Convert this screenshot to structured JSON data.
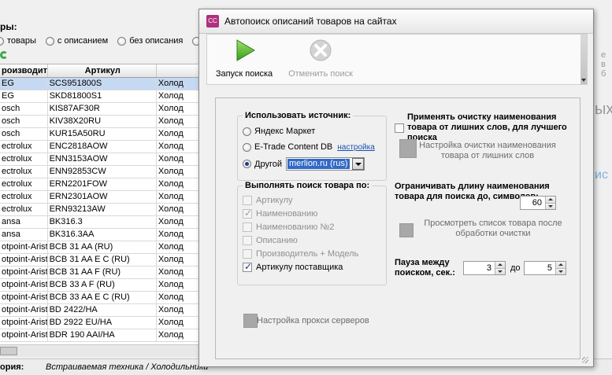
{
  "background": {
    "filter_label": "ры:",
    "radio_options": [
      {
        "label": "товары",
        "checked": true
      },
      {
        "label": "с описанием",
        "checked": false
      },
      {
        "label": "без описания",
        "checked": false
      },
      {
        "label": "пр",
        "checked": false
      }
    ],
    "grid": {
      "columns": [
        "роизводите",
        "Артикул",
        ""
      ],
      "rows": [
        {
          "maker": "EG",
          "article": "SCS951800S",
          "category": "Холод"
        },
        {
          "maker": "EG",
          "article": "SKD81800S1",
          "category": "Холод"
        },
        {
          "maker": "osch",
          "article": "KIS87AF30R",
          "category": "Холод"
        },
        {
          "maker": "osch",
          "article": "KIV38X20RU",
          "category": "Холод"
        },
        {
          "maker": "osch",
          "article": "KUR15A50RU",
          "category": "Холод"
        },
        {
          "maker": "ectrolux",
          "article": "ENC2818AOW",
          "category": "Холод"
        },
        {
          "maker": "ectrolux",
          "article": "ENN3153AOW",
          "category": "Холод"
        },
        {
          "maker": "ectrolux",
          "article": "ENN92853CW",
          "category": "Холод"
        },
        {
          "maker": "ectrolux",
          "article": "ERN2201FOW",
          "category": "Холод"
        },
        {
          "maker": "ectrolux",
          "article": "ERN2301AOW",
          "category": "Холод"
        },
        {
          "maker": "ectrolux",
          "article": "ERN93213AW",
          "category": "Холод"
        },
        {
          "maker": "ansa",
          "article": "BK316.3",
          "category": "Холод"
        },
        {
          "maker": "ansa",
          "article": "BK316.3AA",
          "category": "Холод"
        },
        {
          "maker": "otpoint-Aristo",
          "article": "BCB 31 AA (RU)",
          "category": "Холод"
        },
        {
          "maker": "otpoint-Aristo",
          "article": "BCB 31 AA E C (RU)",
          "category": "Холод"
        },
        {
          "maker": "otpoint-Aristo",
          "article": "BCB 31 AA F (RU)",
          "category": "Холод"
        },
        {
          "maker": "otpoint-Aristo",
          "article": "BCB 33 A F (RU)",
          "category": "Холод"
        },
        {
          "maker": "otpoint-Aristo",
          "article": "BCB 33 AA E C (RU)",
          "category": "Холод"
        },
        {
          "maker": "otpoint-Aristo",
          "article": "BD 2422/HA",
          "category": "Холод"
        },
        {
          "maker": "otpoint-Aristo",
          "article": "BD 2922 EU/HA",
          "category": "Холод"
        },
        {
          "maker": "otpoint-Aristo",
          "article": "BDR 190 AAI/HA",
          "category": "Холод"
        }
      ]
    },
    "status_label": "ория:",
    "status_value": "Встраиваемая техника / Холодильники",
    "right_fragments": [
      "е в б",
      "ых",
      "ис"
    ]
  },
  "dialog": {
    "title": "Автопоиск описаний товаров на сайтах",
    "app_icon_text": "CC",
    "toolbar": {
      "start_label": "Запуск поиска",
      "cancel_label": "Отменить поиск"
    },
    "source_group": {
      "title": "Использовать источник:",
      "options": [
        {
          "label": "Яндекс Маркет",
          "checked": false
        },
        {
          "label": "E-Trade Content DB",
          "checked": false
        },
        {
          "label": "Другой",
          "checked": true
        }
      ],
      "settings_link": "настройка",
      "other_value": "merlion.ru (rus)"
    },
    "search_group": {
      "title": "Выполнять поиск товара по:",
      "options": [
        {
          "label": "Артикулу",
          "checked": false,
          "enabled": false
        },
        {
          "label": "Наименованию",
          "checked": true,
          "enabled": false
        },
        {
          "label": "Наименованию №2",
          "checked": false,
          "enabled": false
        },
        {
          "label": "Описанию",
          "checked": false,
          "enabled": false
        },
        {
          "label": "Производитель + Модель",
          "checked": false,
          "enabled": false
        },
        {
          "label": "Артикулу поставщика",
          "checked": true,
          "enabled": true
        }
      ]
    },
    "cleanup": {
      "checkbox_label": "Применять очистку наименования товара от лишних слов, для лучшего поиска",
      "settings_button": "Настройка очистки наименования товара от лишних слов"
    },
    "limit": {
      "label": "Ограничивать длину наименования товара для поиска до, символов:",
      "value": "60"
    },
    "preview_button": "Просмотреть список товара после обработки очистки",
    "pause": {
      "label": "Пауза между поиском, сек.:",
      "from": "3",
      "to_label": "до",
      "to": "5"
    },
    "proxy_button": "Настройка прокси серверов"
  }
}
